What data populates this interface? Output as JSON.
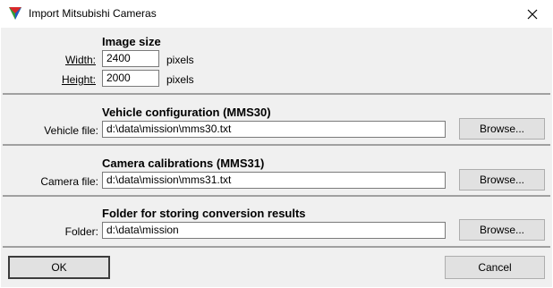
{
  "window": {
    "title": "Import Mitsubishi Cameras",
    "close_glyph": "✕"
  },
  "image_size": {
    "heading": "Image size",
    "width_label": "Width:",
    "width_value": "2400",
    "width_unit": "pixels",
    "height_label": "Height:",
    "height_value": "2000",
    "height_unit": "pixels"
  },
  "vehicle": {
    "heading": "Vehicle configuration (MMS30)",
    "label": "Vehicle file:",
    "value": "d:\\data\\mission\\mms30.txt",
    "browse_label": "Browse..."
  },
  "camera": {
    "heading": "Camera calibrations (MMS31)",
    "label": "Camera file:",
    "value": "d:\\data\\mission\\mms31.txt",
    "browse_label": "Browse..."
  },
  "folder": {
    "heading": "Folder for storing conversion results",
    "label": "Folder:",
    "value": "d:\\data\\mission",
    "browse_label": "Browse..."
  },
  "footer": {
    "ok_label": "OK",
    "cancel_label": "Cancel"
  }
}
